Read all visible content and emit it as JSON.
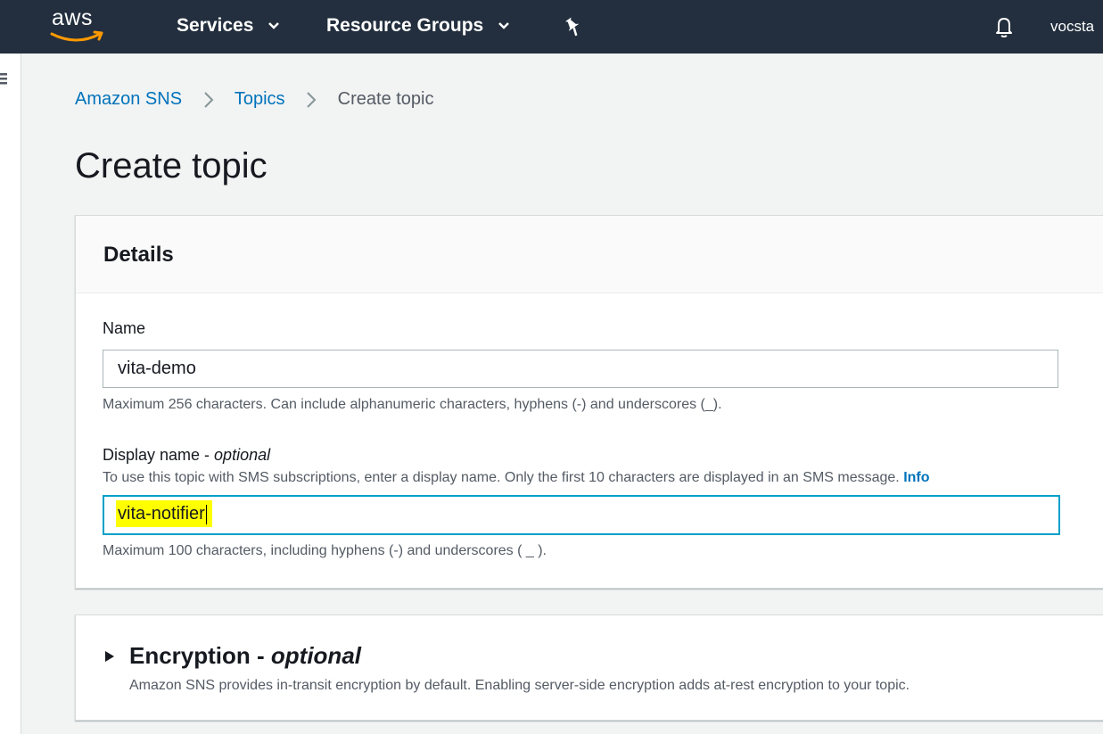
{
  "nav": {
    "logo_text": "aws",
    "services_label": "Services",
    "resource_groups_label": "Resource Groups",
    "account_label": "vocsta"
  },
  "breadcrumb": {
    "items": [
      "Amazon SNS",
      "Topics"
    ],
    "current": "Create topic"
  },
  "page": {
    "title": "Create topic"
  },
  "details": {
    "heading": "Details",
    "name_label": "Name",
    "name_value": "vita-demo",
    "name_hint": "Maximum 256 characters. Can include alphanumeric characters, hyphens (-) and underscores (_).",
    "display_name_label": "Display name - ",
    "display_name_optional": "optional",
    "display_name_description": "To use this topic with SMS subscriptions, enter a display name. Only the first 10 characters are displayed in an SMS message.",
    "info_link": "Info",
    "display_name_value": "vita-notifier",
    "display_name_hint": "Maximum 100 characters, including hyphens (-) and underscores ( _ )."
  },
  "encryption": {
    "heading": "Encryption - ",
    "heading_optional": "optional",
    "description": "Amazon SNS provides in-transit encryption by default. Enabling server-side encryption adds at-rest encryption to your topic."
  },
  "colors": {
    "nav_bg": "#232f3e",
    "link": "#0073bb",
    "focus_border": "#00a1c9",
    "highlight": "#ffff00",
    "aws_orange": "#ff9900"
  },
  "icons": [
    "aws-logo-icon",
    "chevron-down-icon",
    "pin-icon",
    "bell-icon",
    "menu-icon",
    "chevron-right-icon",
    "caret-right-icon"
  ]
}
